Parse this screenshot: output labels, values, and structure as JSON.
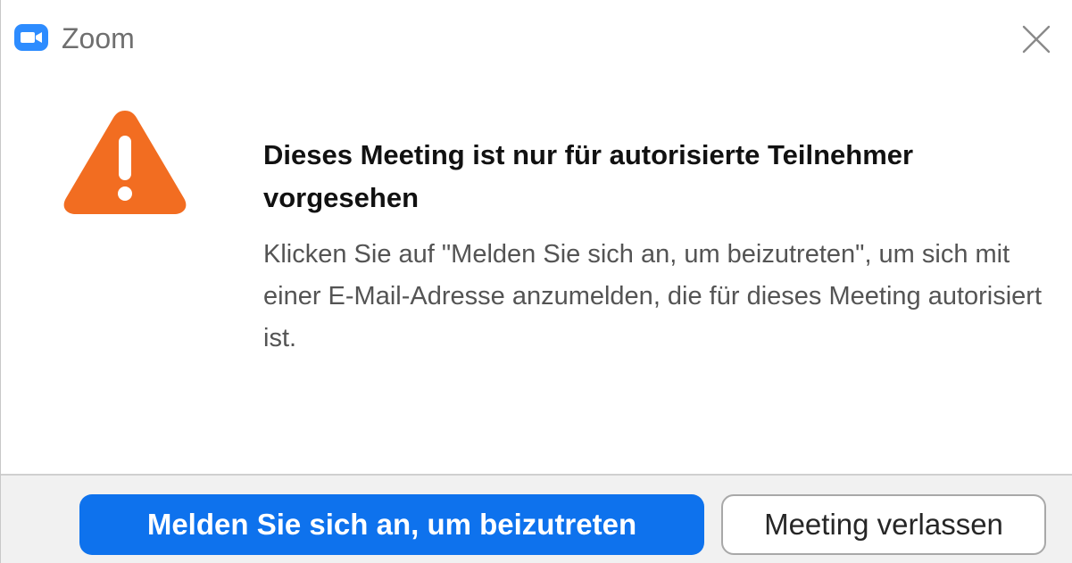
{
  "window": {
    "app_title": "Zoom",
    "app_icon": "zoom-camera-icon",
    "close_icon": "close-icon"
  },
  "dialog": {
    "icon": "warning-icon",
    "heading": "Dieses Meeting ist nur für autorisierte Teilnehmer vorgesehen",
    "message": "Klicken Sie auf \"Melden Sie sich an, um beizutreten\", um sich mit einer E-Mail-Adresse anzumelden, die für dieses Meeting autorisiert ist."
  },
  "buttons": {
    "primary_label": "Melden Sie sich an, um beizutreten",
    "secondary_label": "Meeting verlassen"
  },
  "colors": {
    "accent": "#0e72ed",
    "warning": "#f26d21",
    "footer_bg": "#f1f1f1"
  }
}
